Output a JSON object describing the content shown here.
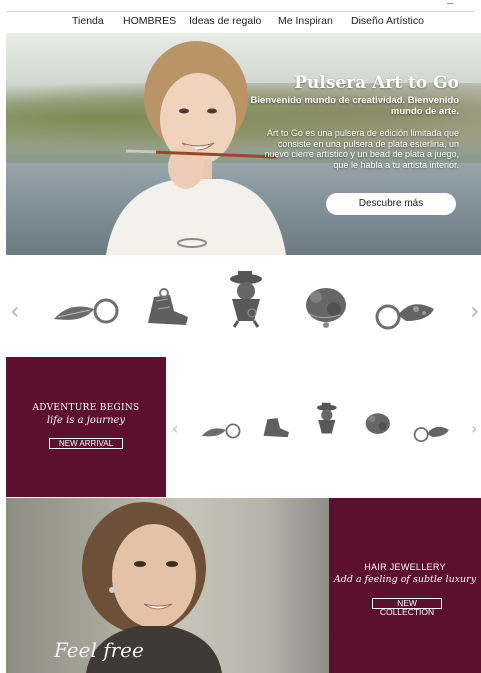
{
  "nav": {
    "items": [
      "Tienda",
      "HOMBRES",
      "Ideas de regalo",
      "Me Inspiran",
      "Diseño Artístico"
    ]
  },
  "hero": {
    "title": "Pulsera Art to Go",
    "subtitle": "Bienvenido mundo de creatividad. Bienvenido mundo de arte.",
    "description": "Art to Go es una pulsera de edición limitada que consiste en una pulsera de plata esterlina, un nuevo cierre artístico y un bead de plata a juego, que le habla a tu artista interior.",
    "cta_label": "Descubre más"
  },
  "carousel": {
    "prev_glyph": "‹",
    "next_glyph": "›"
  },
  "adventure": {
    "heading": "ADVENTURE BEGINS",
    "tagline": "life is a journey",
    "button_label": "NEW ARRIVAL"
  },
  "mini_carousel": {
    "prev_glyph": "‹",
    "next_glyph": "›"
  },
  "feel_free": {
    "script_text": "Feel free"
  },
  "hair": {
    "heading": "HAIR JEWELLERY",
    "tagline": "Add a feeling of subtle luxury",
    "button_label": "NEW COLLECTION"
  },
  "colors": {
    "burgundy": "#5c0f2e",
    "silver": "#6f6f6f"
  }
}
